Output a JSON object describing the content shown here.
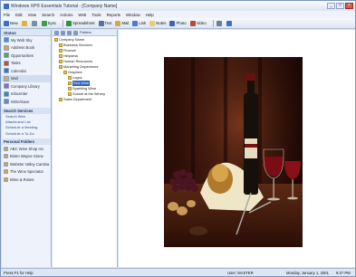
{
  "window": {
    "title": "Windows XP® Essentials Tutorial - [Company Name]"
  },
  "menu": [
    "File",
    "Edit",
    "View",
    "Search",
    "Actions",
    "Web",
    "Tools",
    "Reports",
    "Window",
    "Help"
  ],
  "toolbar": [
    {
      "label": "New",
      "icon": "new-icon",
      "color": "#3a72c8"
    },
    {
      "label": "",
      "icon": "open-folder-icon",
      "color": "#e0b43a"
    },
    {
      "label": "",
      "icon": "print-icon",
      "color": "#7a8fa8"
    },
    {
      "label": "Sync",
      "icon": "sync-icon",
      "color": "#3aa04a"
    },
    {
      "label": "Spreadsheet",
      "icon": "spreadsheet-icon",
      "color": "#2f8f3f"
    },
    {
      "label": "Text",
      "icon": "text-icon",
      "color": "#5a6f9a"
    },
    {
      "label": "Mail",
      "icon": "mail-icon",
      "color": "#d1a84a"
    },
    {
      "label": "Link",
      "icon": "link-icon",
      "color": "#4c7ccc"
    },
    {
      "label": "Notes",
      "icon": "notes-icon",
      "color": "#e6d06a"
    },
    {
      "label": "Photo",
      "icon": "photo-icon",
      "color": "#3c64a8"
    },
    {
      "label": "Video",
      "icon": "video-icon",
      "color": "#b84a3a"
    },
    {
      "label": "",
      "icon": "zoom-icon",
      "color": "#6b7d99"
    },
    {
      "label": "",
      "icon": "help-icon",
      "color": "#3b6fc2"
    }
  ],
  "sidebar": {
    "title": "Status",
    "items": [
      {
        "label": "My Web Sky",
        "icon": "globe-icon",
        "color": "#4a90d8"
      },
      {
        "label": "Address Book",
        "icon": "address-book-icon",
        "color": "#d8a640"
      },
      {
        "label": "Opportunities",
        "icon": "opportunities-icon",
        "color": "#5aa25a"
      },
      {
        "label": "Tasks",
        "icon": "tasks-icon",
        "color": "#c84a3a"
      },
      {
        "label": "Calendar",
        "icon": "calendar-icon",
        "color": "#4a70c0"
      },
      {
        "label": "Mail",
        "icon": "mail-icon",
        "color": "#d0b060"
      },
      {
        "label": "Company Library",
        "icon": "library-icon",
        "color": "#8a6ac8"
      },
      {
        "label": "Infocenter",
        "icon": "infocenter-icon",
        "color": "#2f8fb0"
      },
      {
        "label": "Write/Save",
        "icon": "write-icon",
        "color": "#6a8ab0"
      }
    ],
    "section1_title": "Search Services",
    "section1_links": [
      "Search Web",
      "Attachment List",
      "Schedule a Meeting",
      "Schedule a To-Do"
    ],
    "section2_title": "Personal Folders",
    "section2_items": [
      {
        "label": "ABC Wine Shop Inc.",
        "color": "#d8a640"
      },
      {
        "label": "Bistro Wayne Stone",
        "color": "#d8a640"
      },
      {
        "label": "Webster Valley Cantina",
        "color": "#d8a640"
      },
      {
        "label": "The Wine Spectator",
        "color": "#d8a640"
      },
      {
        "label": "Wine & Roses",
        "color": "#d8a640"
      }
    ]
  },
  "tree": {
    "toolbar_label": "Folders",
    "nodes": [
      {
        "label": "Company Name",
        "indent": 0,
        "selected": false
      },
      {
        "label": "Business Services",
        "indent": 1,
        "selected": false
      },
      {
        "label": "Finance",
        "indent": 1,
        "selected": false
      },
      {
        "label": "Helpdesk",
        "indent": 1,
        "selected": false
      },
      {
        "label": "Human Resources",
        "indent": 1,
        "selected": false
      },
      {
        "label": "Marketing Department",
        "indent": 1,
        "selected": false
      },
      {
        "label": "Graphics",
        "indent": 2,
        "selected": false
      },
      {
        "label": "Logos",
        "indent": 3,
        "selected": false
      },
      {
        "label": "Red Wine",
        "indent": 3,
        "selected": true
      },
      {
        "label": "Sparkling Wine",
        "indent": 3,
        "selected": false
      },
      {
        "label": "Sunset at the Winery",
        "indent": 3,
        "selected": false
      },
      {
        "label": "Sales Department",
        "indent": 1,
        "selected": false
      }
    ]
  },
  "viewer": {
    "image_name": "red-wine-still-life-photo"
  },
  "status": {
    "left": "Press F1 for Help",
    "user": "User: MASTER",
    "date": "Monday, January 1, 2001",
    "time": "9:27 PM"
  }
}
